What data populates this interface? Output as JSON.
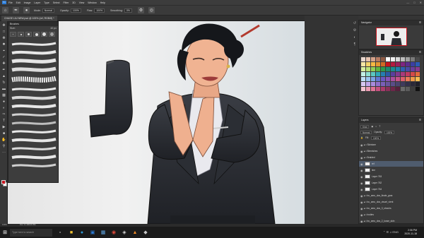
{
  "menubar": {
    "logo": "Ps",
    "items": [
      "File",
      "Edit",
      "Image",
      "Layer",
      "Type",
      "Select",
      "Filter",
      "3D",
      "View",
      "Window",
      "Help"
    ]
  },
  "options": {
    "mode_label": "Mode:",
    "mode_value": "Normal",
    "opacity_label": "Opacity:",
    "opacity_value": "100%",
    "flow_label": "Flow:",
    "flow_value": "100%",
    "smoothing_label": "Smoothing:",
    "smoothing_value": "0%"
  },
  "document": {
    "tab_title": "CHASE LIU NEW.psd @ 100% (ref, RGB/8) *"
  },
  "brush_panel": {
    "title": "Brushes",
    "size_label": "Size:",
    "size_value": "42 px"
  },
  "navigator": {
    "title": "Navigator"
  },
  "swatches": {
    "title": "Swatches",
    "colors": [
      "#e9d7ce",
      "#e7c3b0",
      "#d5a28a",
      "#b77b62",
      "#8e5a45",
      "#ffffff",
      "#f0f0f0",
      "#d9d9d9",
      "#bdbdbd",
      "#a0a0a0",
      "#7a7a7a",
      "#4a4a4a",
      "#f6e6a6",
      "#f4d36b",
      "#f5b944",
      "#e59731",
      "#d16a24",
      "#c8141e",
      "#b51a40",
      "#9c1f5b",
      "#7f2480",
      "#5c2d8f",
      "#3b3fa3",
      "#2b5bb6",
      "#d9ee9f",
      "#bde27a",
      "#92cf56",
      "#5fb53e",
      "#2f9a4a",
      "#1d8a6e",
      "#1c8a8f",
      "#1f7fae",
      "#2f5fb0",
      "#4a4aa8",
      "#6a3d9e",
      "#8b3a8f",
      "#c4f0e4",
      "#91e0d0",
      "#5cc8c0",
      "#2fa8b8",
      "#247fb0",
      "#2a5aa6",
      "#5a3f9e",
      "#823a90",
      "#a83a7c",
      "#c23a62",
      "#d34a4a",
      "#e26a3c",
      "#bfe0f6",
      "#9bc7ef",
      "#7aa4e4",
      "#6278d2",
      "#6a58c2",
      "#8a52b6",
      "#aa4f9e",
      "#c75288",
      "#dd5f6c",
      "#ea7a56",
      "#f09a4a",
      "#f3bd52",
      "#d7c8f0",
      "#c1a8ea",
      "#a98bdc",
      "#9070cc",
      "#7a5fb8",
      "#6a55a0",
      "#5a4d88",
      "#4c4470",
      "#3f3a5c",
      "#33304a",
      "#2a2838",
      "#20202a",
      "#f3c4d0",
      "#ec9bb2",
      "#df7496",
      "#c85180",
      "#a93b6c",
      "#8b2f5a",
      "#6e264a",
      "#56203c",
      "#6a6a6a",
      "#5c5c5c",
      "#3c3c3c",
      "#111111"
    ]
  },
  "layers": {
    "title": "Layers",
    "kind_label": "Kind",
    "blend_value": "Normal",
    "opacity_label": "Opacity:",
    "opacity_value": "100%",
    "fill_label": "Fill:",
    "fill_value": "100%",
    "rows": [
      {
        "name": "Skintone",
        "thumb": false
      },
      {
        "name": "Blemishes",
        "thumb": false
      },
      {
        "name": "Braided",
        "thumb": false
      },
      {
        "name": "ref",
        "thumb": true
      },
      {
        "name": "line",
        "thumb": true
      },
      {
        "name": "Layer 763",
        "thumb": true
      },
      {
        "name": "Layer 762",
        "thumb": true
      },
      {
        "name": "Layer 764",
        "thumb": true
      },
      {
        "name": "bu_amo_dos_finale_gras",
        "thumb": false
      },
      {
        "name": "bu_amo_dos_visuel_vient",
        "thumb": false
      },
      {
        "name": "bu_amo_dos_3_shouhs",
        "thumb": false
      },
      {
        "name": "bodies",
        "thumb": false
      },
      {
        "name": "bu_amo_dos_2_loose_skin",
        "thumb": false
      }
    ]
  },
  "statusbar": {
    "zoom": "100%",
    "doc_info": "Doc: 11.4M/215.8M"
  },
  "taskbar": {
    "search_placeholder": "Type here to search",
    "tray_lang": "ENG",
    "time": "2:06 PM",
    "date": "2020-11-18"
  }
}
